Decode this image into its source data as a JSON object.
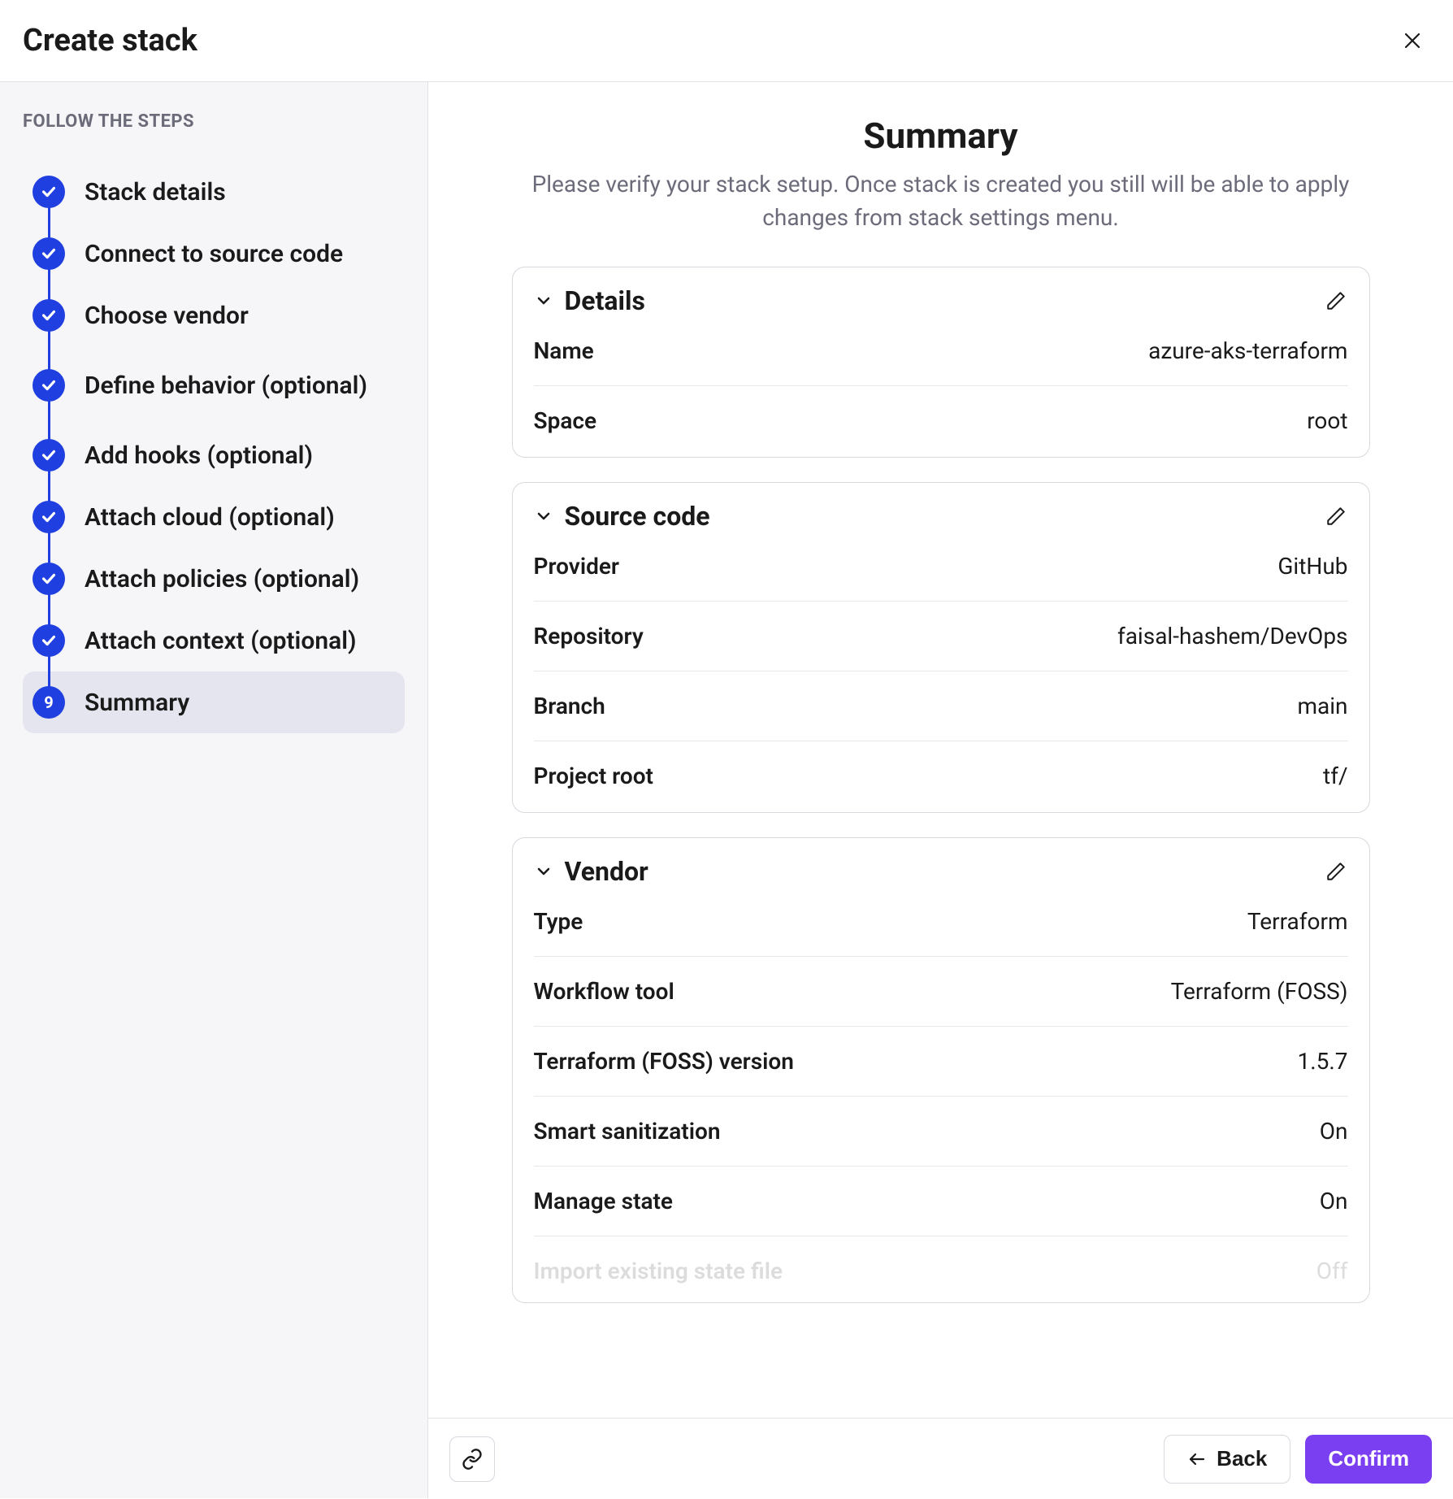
{
  "header": {
    "title": "Create stack"
  },
  "sidebar": {
    "eyebrow": "FOLLOW THE STEPS",
    "steps": [
      {
        "label": "Stack details",
        "done": true
      },
      {
        "label": "Connect to source code",
        "done": true
      },
      {
        "label": "Choose vendor",
        "done": true
      },
      {
        "label": "Define behavior (optional)",
        "done": true
      },
      {
        "label": "Add hooks (optional)",
        "done": true
      },
      {
        "label": "Attach cloud (optional)",
        "done": true
      },
      {
        "label": "Attach policies (optional)",
        "done": true
      },
      {
        "label": "Attach context (optional)",
        "done": true
      },
      {
        "label": "Summary",
        "done": false,
        "active": true,
        "number": "9"
      }
    ]
  },
  "main": {
    "title": "Summary",
    "subtitle": "Please verify your stack setup. Once stack is created you still will be able to apply changes from stack settings menu."
  },
  "cards": {
    "details": {
      "title": "Details",
      "rows": {
        "name_label": "Name",
        "name_value": "azure-aks-terraform",
        "space_label": "Space",
        "space_value": "root"
      }
    },
    "source": {
      "title": "Source code",
      "rows": {
        "provider_label": "Provider",
        "provider_value": "GitHub",
        "repo_label": "Repository",
        "repo_value": "faisal-hashem/DevOps",
        "branch_label": "Branch",
        "branch_value": "main",
        "root_label": "Project root",
        "root_value": "tf/"
      }
    },
    "vendor": {
      "title": "Vendor",
      "rows": {
        "type_label": "Type",
        "type_value": "Terraform",
        "tool_label": "Workflow tool",
        "tool_value": "Terraform (FOSS)",
        "version_label": "Terraform (FOSS) version",
        "version_value": "1.5.7",
        "sanit_label": "Smart sanitization",
        "sanit_value": "On",
        "state_label": "Manage state",
        "state_value": "On",
        "import_label": "Import existing state file",
        "import_value": "Off"
      }
    }
  },
  "footer": {
    "back": "Back",
    "confirm": "Confirm"
  }
}
